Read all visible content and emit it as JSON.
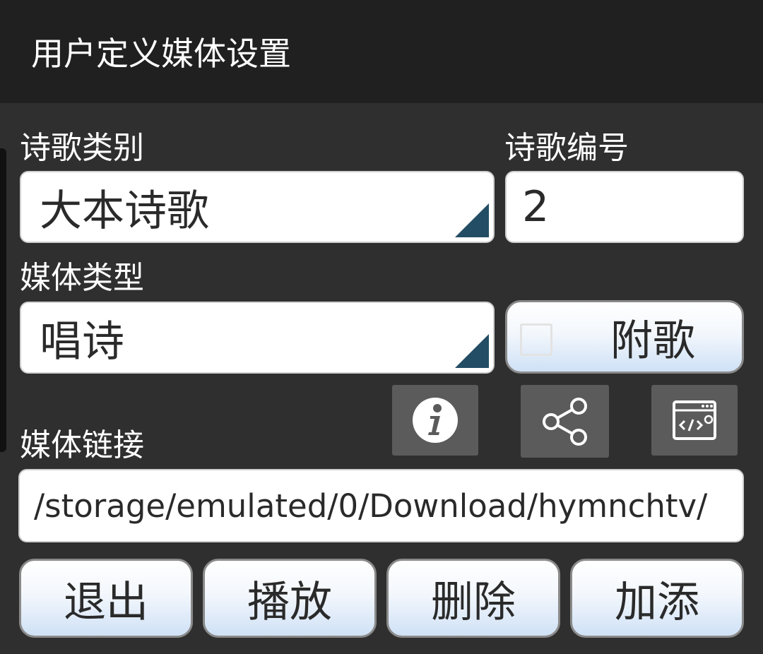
{
  "titlebar": {
    "title": "用户定义媒体设置"
  },
  "form": {
    "hymn_category_label": "诗歌类别",
    "hymn_category_value": "大本诗歌",
    "hymn_number_label": "诗歌编号",
    "hymn_number_value": "2",
    "media_type_label": "媒体类型",
    "media_type_value": "唱诗",
    "attach_song_label": "附歌",
    "attach_song_checked": false,
    "media_link_label": "媒体链接",
    "media_link_value": "/storage/emulated/0/Download/hymnchtv/"
  },
  "icons": {
    "info": "info-icon",
    "share": "share-icon",
    "code": "code-window-icon"
  },
  "actions": {
    "exit": "退出",
    "play": "播放",
    "delete": "删除",
    "add": "加添"
  },
  "colors": {
    "background": "#2f2f2f",
    "titlebar": "#202020",
    "spinner_arrow": "#234d64",
    "button_gradient_bottom": "#cfe1f6"
  }
}
